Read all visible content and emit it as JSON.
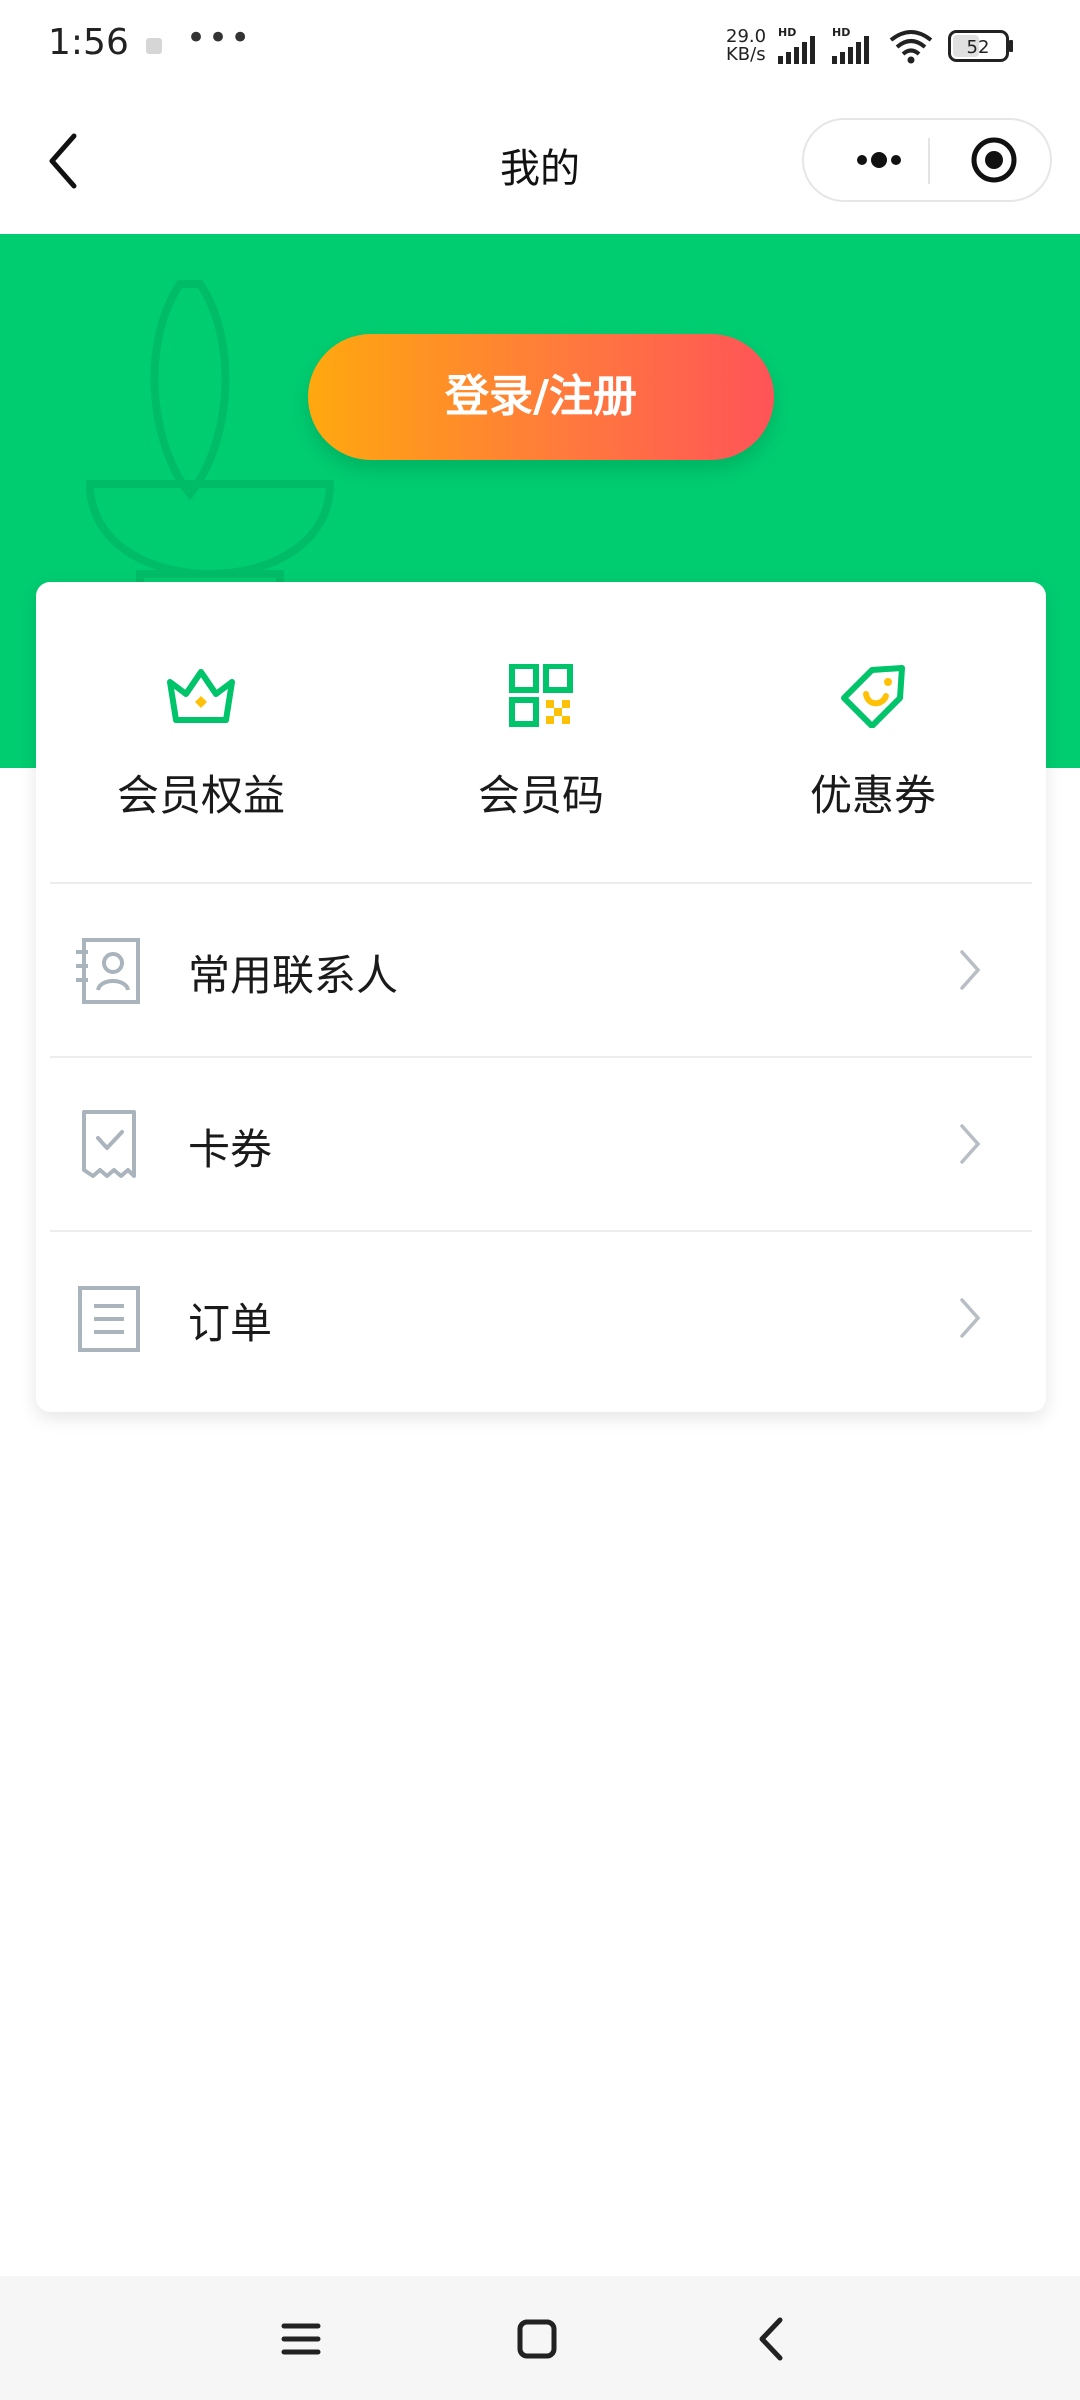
{
  "status_bar": {
    "time": "1:56",
    "more": "•••",
    "net_speed_value": "29.0",
    "net_speed_unit": "KB/s",
    "hd_label": "HD",
    "battery_level": "52"
  },
  "title_bar": {
    "title": "我的",
    "back_icon": "chevron-left-icon",
    "more_icon": "more-dots-icon",
    "close_icon": "target-circle-icon"
  },
  "banner": {
    "login_label": "登录/注册",
    "background_color": "#00cc70",
    "gradient_start": "#ffa80e",
    "gradient_end": "#ff5358"
  },
  "quick_actions": [
    {
      "label": "会员权益",
      "icon": "crown-icon"
    },
    {
      "label": "会员码",
      "icon": "qr-code-icon"
    },
    {
      "label": "优惠券",
      "icon": "coupon-tag-icon"
    }
  ],
  "menu": [
    {
      "label": "常用联系人",
      "icon": "contact-card-icon"
    },
    {
      "label": "卡券",
      "icon": "voucher-icon"
    },
    {
      "label": "订单",
      "icon": "order-document-icon"
    }
  ],
  "nav_bar": {
    "menu_icon": "menu-lines-icon",
    "home_icon": "home-square-icon",
    "back_icon": "back-chevron-icon"
  },
  "colors": {
    "accent_green": "#00cc70",
    "icon_gray": "#aab4bd",
    "coupon_yellow": "#ffc107"
  }
}
